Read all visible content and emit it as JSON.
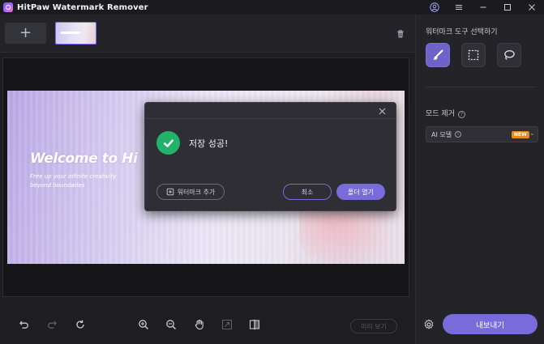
{
  "app": {
    "title": "HitPaw Watermark Remover"
  },
  "canvas": {
    "headline": "Welcome to Hi",
    "subline": "Free up your infinite creativity beyond boundaries"
  },
  "right_panel": {
    "tool_section_label": "워터마크 도구 선택하기",
    "tools": [
      {
        "name": "brush",
        "active": true
      },
      {
        "name": "rectangle-select",
        "active": false
      },
      {
        "name": "lasso",
        "active": false
      }
    ],
    "mode_label": "모드 제거",
    "mode_select": {
      "value": "AI 모델",
      "badge": "NEW"
    },
    "export_label": "내보내기"
  },
  "toolbar": {
    "preview_label": "미리 보기"
  },
  "dialog": {
    "message": "저장 성공!",
    "add_watermark_label": "워터마크 추가",
    "cancel_label": "최소",
    "open_folder_label": "폴더 열기"
  },
  "colors": {
    "accent": "#7a6bdc",
    "success": "#23b26b",
    "badge": "#e58a1e",
    "background": "#1e1e22"
  }
}
